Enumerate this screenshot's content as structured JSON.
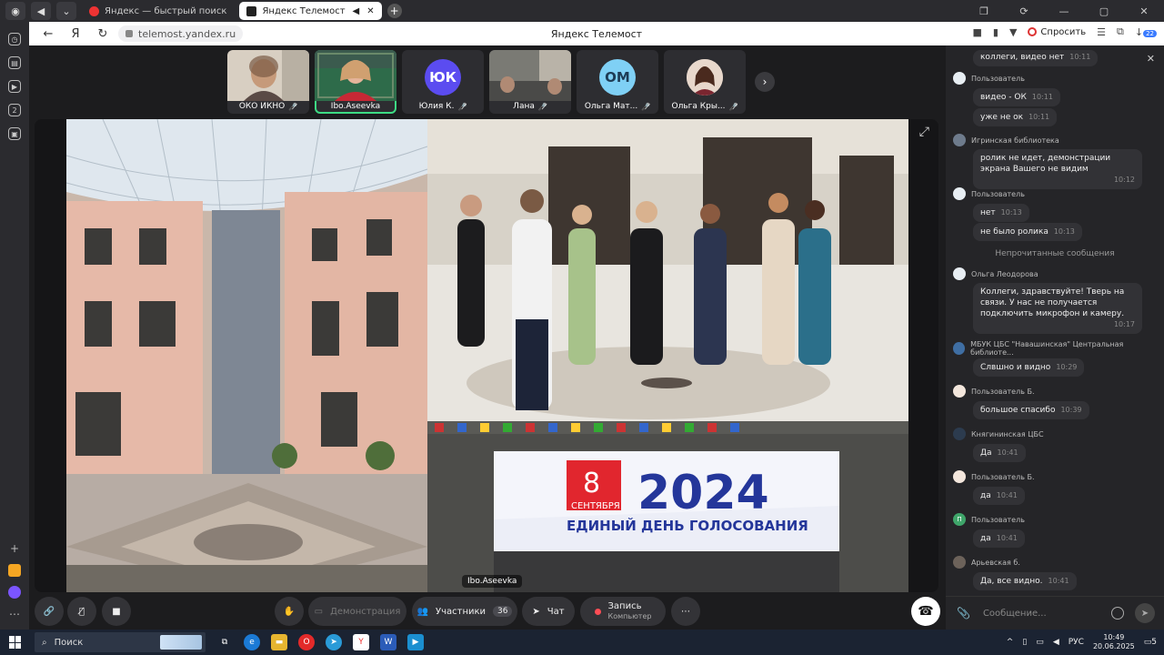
{
  "browser": {
    "tabs": [
      {
        "label": "Яндекс — быстрый поиск"
      },
      {
        "label": "Яндекс Телемост"
      }
    ],
    "url": "telemost.yandex.ru",
    "page_title": "Яндекс Телемост",
    "ask_label": "Спросить",
    "downloads_badge": "22",
    "rail_badge": "2"
  },
  "participants": [
    {
      "name": "ОКО ИКНО",
      "type": "video"
    },
    {
      "name": "Ibo.Aseevka",
      "type": "video",
      "speaking": true
    },
    {
      "name": "Юлия К.",
      "type": "avatar",
      "initials": "ЮК",
      "color": "#5b4cf0"
    },
    {
      "name": "Лана",
      "type": "video"
    },
    {
      "name": "Ольга Мат...",
      "type": "avatar",
      "initials": "ОМ",
      "color": "#7fd0f5"
    },
    {
      "name": "Ольга Кры...",
      "type": "video"
    }
  ],
  "stage": {
    "speaker_label": "Ibo.Aseevka",
    "poster": {
      "day": "8",
      "month": "СЕНТЯБРЯ",
      "year": "2024",
      "caption": "ЕДИНЫЙ ДЕНЬ ГОЛОСОВАНИЯ"
    }
  },
  "toolbar": {
    "demo_label": "Демонстрация",
    "participants_label": "Участники",
    "participants_count": "36",
    "chat_label": "Чат",
    "record_label": "Запись",
    "record_sub": "Компьютер"
  },
  "chat": {
    "unread_divider": "Непрочитанные сообщения",
    "placeholder": "Сообщение...",
    "messages": [
      {
        "author": "",
        "text": "коллеги, видео нет",
        "time": "10:11"
      },
      {
        "author": "Пользователь",
        "text": "видео - ОК",
        "time": "10:11"
      },
      {
        "author": "",
        "text": "уже не ок",
        "time": "10:11"
      },
      {
        "author": "Игринская библиотека",
        "text": "ролик не идет, демонстрации экрана Вашего не видим",
        "time": "10:12"
      },
      {
        "author": "Пользователь",
        "text": "нет",
        "time": "10:13"
      },
      {
        "author": "",
        "text": "не было ролика",
        "time": "10:13"
      },
      {
        "author": "Ольга Леодорова",
        "text": "Коллеги, здравствуйте! Тверь на связи. У нас не получается подключить микрофон и камеру.",
        "time": "10:17"
      },
      {
        "author": "МБУК ЦБС \"Навашинская\" Центральная библиоте...",
        "text": "Слвшно и видно",
        "time": "10:29"
      },
      {
        "author": "Пользователь Б.",
        "text": "большое спасибо",
        "time": "10:39"
      },
      {
        "author": "Княгининская ЦБС",
        "text": "Да",
        "time": "10:41"
      },
      {
        "author": "Пользователь Б.",
        "text": "да",
        "time": "10:41"
      },
      {
        "author": "Пользователь",
        "text": "да",
        "time": "10:41",
        "initial": "П"
      },
      {
        "author": "Арьевская б.",
        "text": "Да, все видно.",
        "time": "10:41"
      }
    ]
  },
  "taskbar": {
    "search_label": "Поиск",
    "lang": "РУС",
    "time": "10:49",
    "date": "20.06.2025",
    "notif": "5"
  }
}
